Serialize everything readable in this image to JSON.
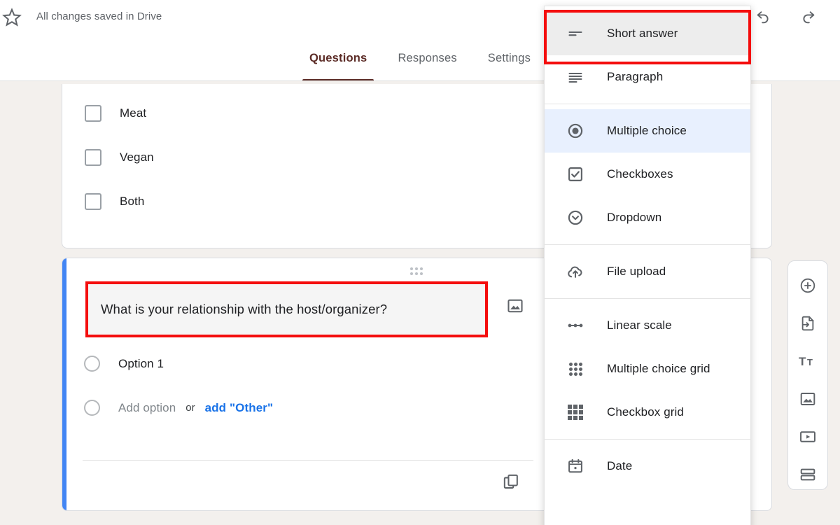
{
  "header": {
    "save_status": "All changes saved in Drive",
    "star_icon": "star-outline-icon",
    "undo_icon": "undo-icon",
    "redo_icon": "redo-icon",
    "send_button_label": "",
    "send_button_color": "#673ab7",
    "tabs": [
      {
        "label": "Questions",
        "active": true
      },
      {
        "label": "Responses",
        "active": false
      },
      {
        "label": "Settings",
        "active": false
      }
    ],
    "active_tab_color": "#5b2b26"
  },
  "food_card": {
    "options": [
      {
        "label": "Meat"
      },
      {
        "label": "Vegan"
      },
      {
        "label": "Both"
      }
    ]
  },
  "question_card": {
    "accent_color": "#4285f4",
    "drag_handle_icon": "drag-handle-icon",
    "title": "What is your relationship with the host/organizer?",
    "title_highlight_color": "#f40d0d",
    "image_icon": "image-icon",
    "options": [
      {
        "label": "Option 1"
      }
    ],
    "add_option_label": "Add option",
    "or_label": "or",
    "add_other_label": "add \"Other\"",
    "add_other_color": "#1a73e8",
    "duplicate_icon": "duplicate-icon"
  },
  "tool_rail": {
    "buttons": [
      {
        "icon": "add-question-icon"
      },
      {
        "icon": "import-questions-icon"
      },
      {
        "icon": "add-title-and-description-icon"
      },
      {
        "icon": "add-image-icon"
      },
      {
        "icon": "add-video-icon"
      },
      {
        "icon": "add-section-icon"
      }
    ]
  },
  "question_type_menu": {
    "highlight_color": "#f40d0d",
    "selected_bg": "#e8f0fe",
    "hover_bg": "#ededed",
    "items": [
      {
        "label": "Short answer",
        "icon": "short-answer-icon",
        "state": "hover"
      },
      {
        "label": "Paragraph",
        "icon": "paragraph-icon",
        "state": "normal"
      },
      {
        "label": "Multiple choice",
        "icon": "radio-button-icon",
        "state": "selected"
      },
      {
        "label": "Checkboxes",
        "icon": "checkbox-icon",
        "state": "normal"
      },
      {
        "label": "Dropdown",
        "icon": "dropdown-icon",
        "state": "normal"
      },
      {
        "label": "File upload",
        "icon": "file-upload-icon",
        "state": "normal"
      },
      {
        "label": "Linear scale",
        "icon": "linear-scale-icon",
        "state": "normal"
      },
      {
        "label": "Multiple choice grid",
        "icon": "multiple-choice-grid-icon",
        "state": "normal"
      },
      {
        "label": "Checkbox grid",
        "icon": "checkbox-grid-icon",
        "state": "normal"
      },
      {
        "label": "Date",
        "icon": "date-icon",
        "state": "normal"
      }
    ]
  }
}
